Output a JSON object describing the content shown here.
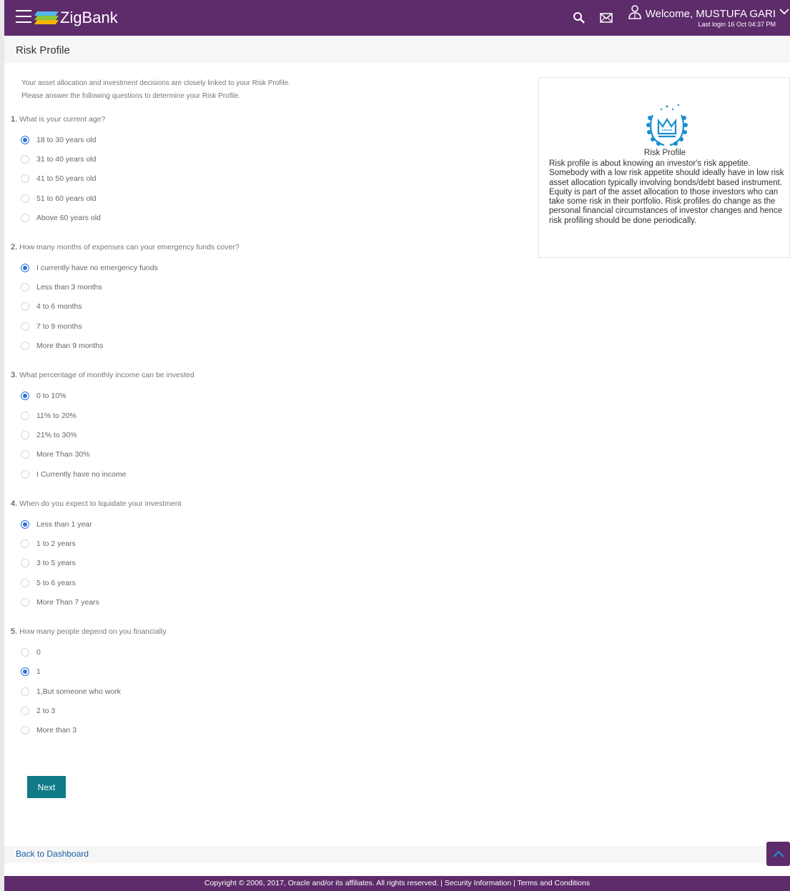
{
  "header": {
    "brand": "ZigBank",
    "welcome": "Welcome, MUSTUFA GARI",
    "last_login": "Last login 16 Oct 04:37 PM",
    "brand_color": "#5e2b6b"
  },
  "page": {
    "title": "Risk Profile"
  },
  "intro": {
    "line1": "Your asset allocation and investment decisions are closely linked to your Risk Profile.",
    "line2": "Please answer the following questions to determine your Risk Profile."
  },
  "questions": [
    {
      "number": "1.",
      "text": "What is your current age?",
      "options": [
        "18 to 30 years old",
        "31 to 40 years old",
        "41 to 50 years old",
        "51 to 60 years old",
        "Above 60 years old"
      ],
      "selected": 0
    },
    {
      "number": "2.",
      "text": "How many months of expenses can your emergency funds cover?",
      "options": [
        "I currently have no emergency funds",
        "Less than 3 months",
        "4 to 6 months",
        "7 to 9 months",
        "More than 9 months"
      ],
      "selected": 0
    },
    {
      "number": "3.",
      "text": "What percentage of monthly income can be invested",
      "options": [
        "0 to 10%",
        "11% to 20%",
        "21% to 30%",
        "More Than 30%",
        "I Currently have no income"
      ],
      "selected": 0
    },
    {
      "number": "4.",
      "text": "When do you expect to liquidate your investment",
      "options": [
        "Less than 1 year",
        "1 to 2 years",
        "3 to 5 years",
        "5 to 6 years",
        "More Than 7 years"
      ],
      "selected": 0
    },
    {
      "number": "5.",
      "text": "How many people depend on you financially",
      "options": [
        "0",
        "1",
        "1,But someone who work",
        "2 to 3",
        "More than 3"
      ],
      "selected": 1
    }
  ],
  "actions": {
    "next_label": "Next",
    "back_label": "Back to Dashboard"
  },
  "info_card": {
    "title": "Risk Profile",
    "text": "Risk profile is about knowing an investor's risk appetite. Somebody with a low risk appetite should ideally have in low risk asset allocation typically involving bonds/debt based instrument. Equity is part of the asset allocation to those investors who can take some risk in their portfolio. Risk profiles do change as the personal financial circumstances of investor changes and hence risk profiling should be done periodically.",
    "icon": "crown-laurel-icon"
  },
  "footer": {
    "copyright": "Copyright © 2006, 2017, Oracle and/or its affiliates. All rights reserved. | Security Information | Terms and Conditions"
  }
}
